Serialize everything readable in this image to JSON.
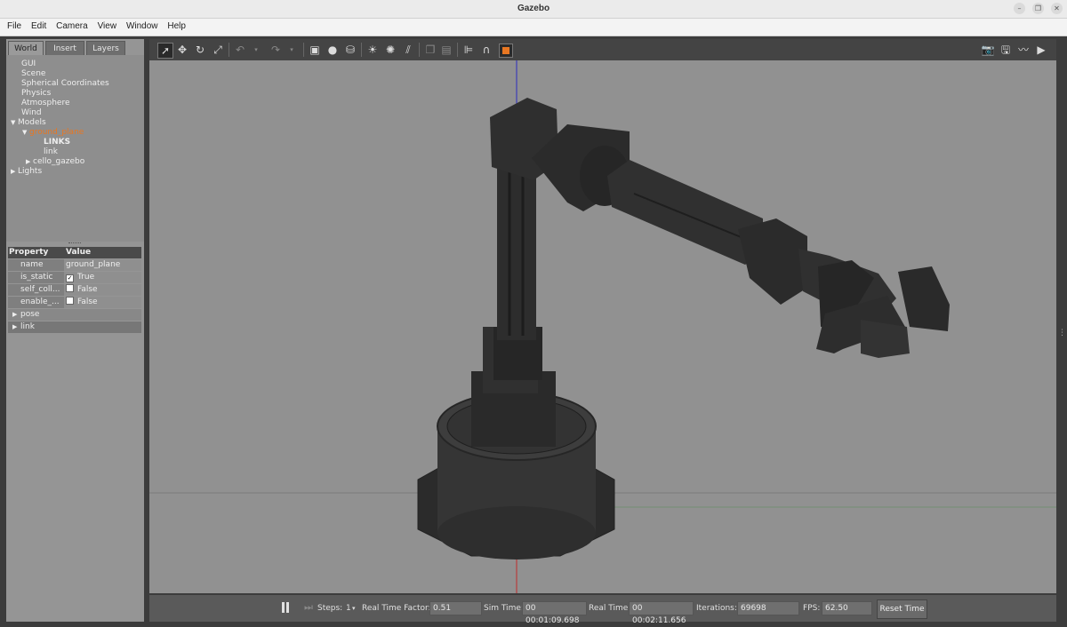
{
  "window": {
    "title": "Gazebo"
  },
  "menu": [
    "File",
    "Edit",
    "Camera",
    "View",
    "Window",
    "Help"
  ],
  "tabs": [
    "World",
    "Insert",
    "Layers"
  ],
  "tree": {
    "gui": "GUI",
    "scene": "Scene",
    "spherical": "Spherical Coordinates",
    "physics": "Physics",
    "atmosphere": "Atmosphere",
    "wind": "Wind",
    "models": "Models",
    "ground_plane": "ground_plane",
    "links_header": "LINKS",
    "link": "link",
    "cello_gazebo": "cello_gazebo",
    "lights": "Lights"
  },
  "properties": {
    "header_property": "Property",
    "header_value": "Value",
    "rows": [
      {
        "name": "name",
        "value": "ground_plane"
      },
      {
        "name": "is_static",
        "value": "True",
        "checked": true
      },
      {
        "name": "self_coll...",
        "value": "False",
        "checked": false
      },
      {
        "name": "enable_...",
        "value": "False",
        "checked": false
      }
    ],
    "sections": [
      "pose",
      "link"
    ]
  },
  "bottom": {
    "steps_label": "Steps:",
    "steps_value": "1",
    "rtf_label": "Real Time Factor:",
    "rtf_value": "0.51",
    "sim_time_label": "Sim Time:",
    "sim_time_value": "00 00:01:09.698",
    "real_time_label": "Real Time:",
    "real_time_value": "00 00:02:11.656",
    "iterations_label": "Iterations:",
    "iterations_value": "69698",
    "fps_label": "FPS:",
    "fps_value": "62.50",
    "reset_label": "Reset Time"
  },
  "colors": {
    "selected_item": "#e87722",
    "viewport_bg": "#919191",
    "robot": "#2f2f2f"
  }
}
